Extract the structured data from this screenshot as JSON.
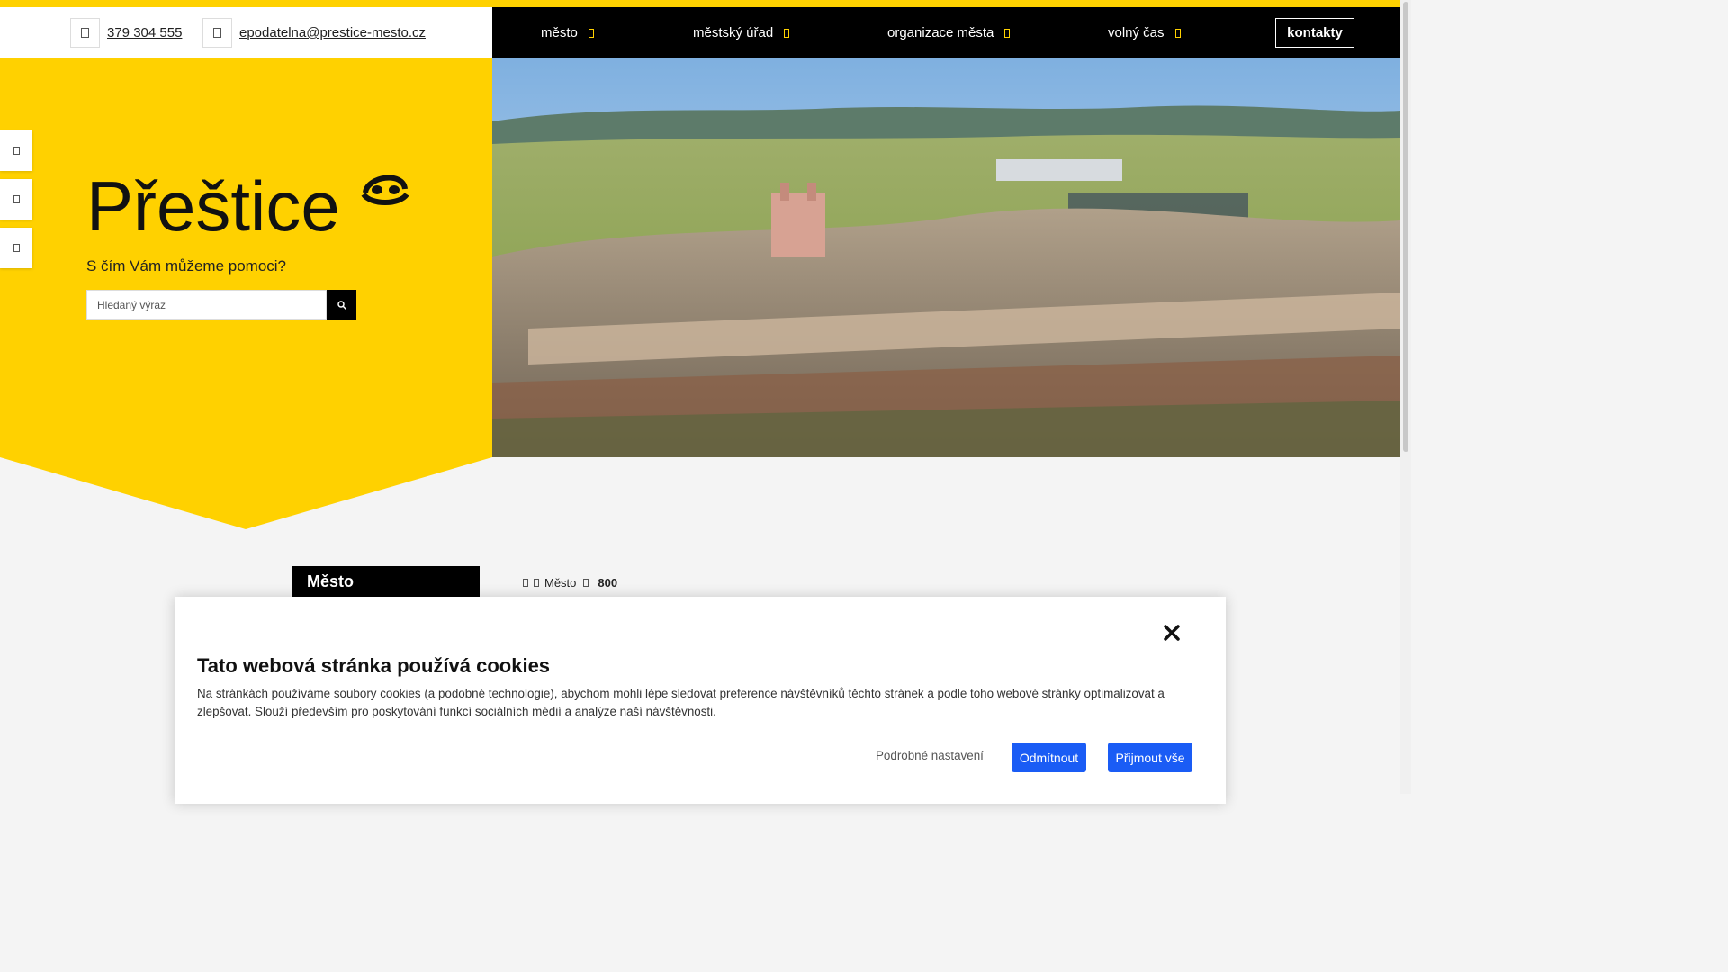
{
  "header": {
    "phone": "379 304 555",
    "email": "epodatelna@prestice-mesto.cz",
    "phone_icon": "phone-icon",
    "email_icon": "envelope-icon"
  },
  "nav": {
    "items": [
      {
        "label": "město"
      },
      {
        "label": "městský úřad"
      },
      {
        "label": "organizace města"
      },
      {
        "label": "volný čas"
      }
    ],
    "contacts_label": "kontakty"
  },
  "hero": {
    "logo_text": "Přeštice",
    "tagline": "S čím Vám můžeme pomoci?",
    "search_placeholder": "Hledaný výraz",
    "brand_color": "#ffd100"
  },
  "sidebar": {
    "title": "Město"
  },
  "breadcrumb": {
    "items": [
      "Město",
      "800"
    ]
  },
  "cookie": {
    "title": "Tato webová stránka používá cookies",
    "text": "Na stránkách používáme soubory cookies (a podobné technologie), abychom mohli lépe sledovat preference návštěvníků těchto stránek a podle toho webové stránky optimalizovat a zlepšovat. Slouží především pro poskytování funkcí sociálních médií a analýze naší návštěvnosti.",
    "details_label": "Podrobné nastavení",
    "reject_label": "Odmítnout",
    "accept_label": "Přijmout vše",
    "button_color": "#1a5cf5"
  }
}
